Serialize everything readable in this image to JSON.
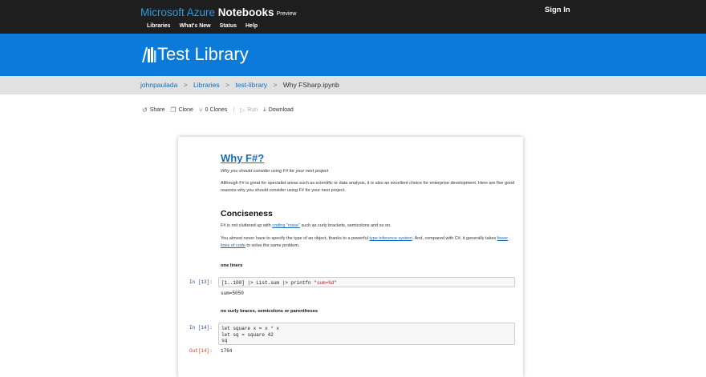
{
  "header": {
    "brand_ms": "Microsoft Azure",
    "brand_nb": "Notebooks",
    "brand_tag": "Preview",
    "signin": "Sign In",
    "nav": [
      "Libraries",
      "What's New",
      "Status",
      "Help"
    ]
  },
  "banner": {
    "title": "Test Library"
  },
  "breadcrumb": {
    "items": [
      "johnpaulada",
      "Libraries",
      "test-library"
    ],
    "current": "Why FSharp.ipynb",
    "separator": ">"
  },
  "actions": {
    "share": "Share",
    "clone": "Clone",
    "clones": "0 Clones",
    "run": "Run",
    "download": "Download"
  },
  "notebook": {
    "title": "Why F#?",
    "subtitle": "Why you should consider using F# for your next project",
    "intro": "Although F# is great for specialist areas such as scientific or data analysis, it is also an excellent choice for enterprise development. Here are five good reasons why you should consider using F# for your next project.",
    "section": "Conciseness",
    "p1_pre": "F# is not cluttered up with ",
    "p1_link": "coding \"noise\"",
    "p1_post": " such as curly brackets, semicolons and so on.",
    "p2_pre": "You almost never have to specify the type of an object, thanks to a powerful ",
    "p2_link": "type inference system",
    "p2_mid": ". And, compared with C#, it generally takes ",
    "p2_link2": "fewer lines of code",
    "p2_post": " to solve the same problem.",
    "sub1": "one liners",
    "cell1_prompt": "In [13]:",
    "cell1_code": "[1..100] |> List.sum |> printfn ",
    "cell1_str": "\"sum=%d\"",
    "cell1_output": "sum=5050",
    "sub2": "no curly braces, semicolons or parentheses",
    "cell2_prompt": "In [14]:",
    "cell2_code": "let square x = x * x\nlet sq = square 42\nsq",
    "cell2_out_prompt": "Out[14]:",
    "cell2_output": "1764"
  }
}
